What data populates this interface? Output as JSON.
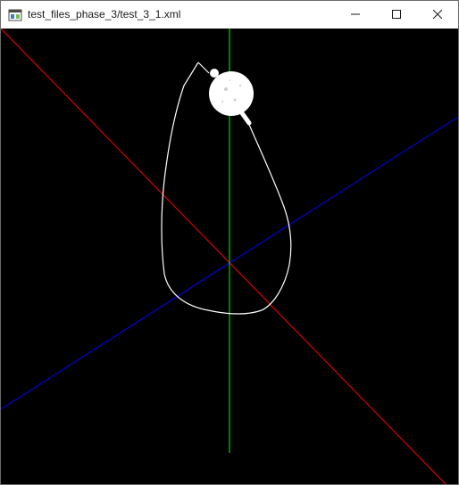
{
  "window": {
    "title": "test_files_phase_3/test_3_1.xml",
    "app_icon": "window-app-icon",
    "controls": {
      "minimize_icon": "minimize-icon",
      "maximize_icon": "maximize-icon",
      "close_icon": "close-icon"
    }
  },
  "scene": {
    "background_color": "#000000",
    "axes": {
      "x_color": "#ff0000",
      "y_color": "#00ff00",
      "z_color": "#0000ff"
    },
    "model_color": "#ffffff"
  }
}
